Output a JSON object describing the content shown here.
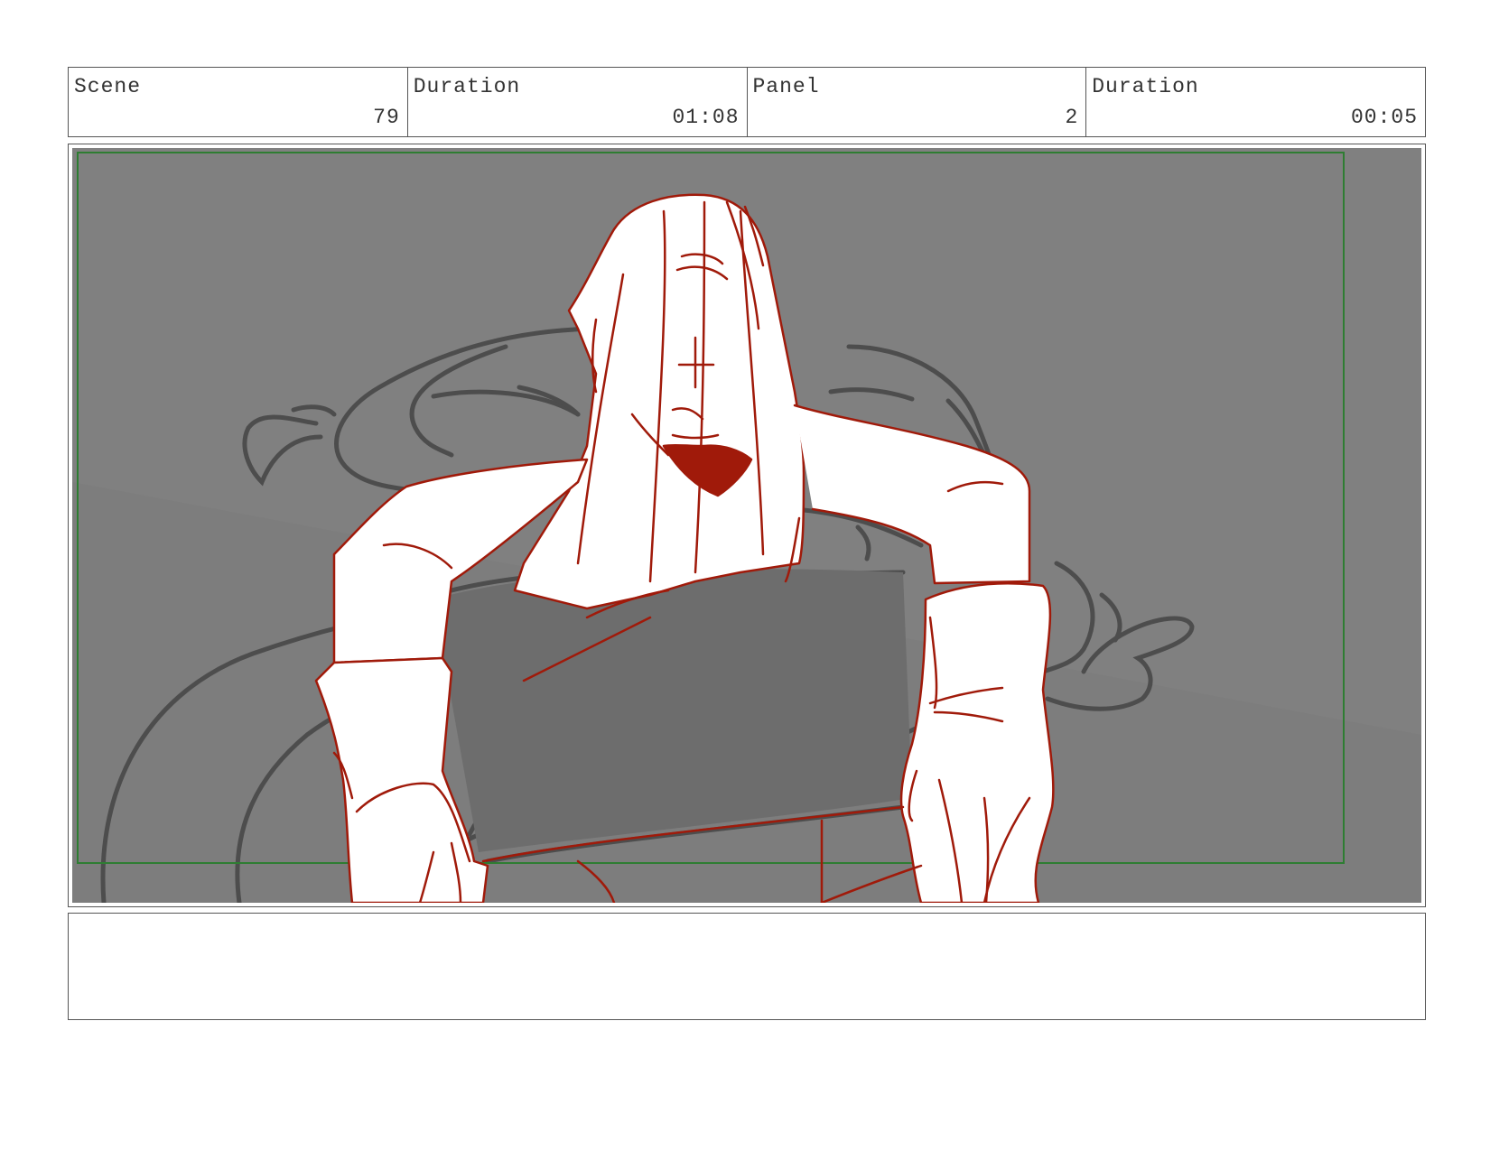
{
  "header": {
    "scene": {
      "label": "Scene",
      "value": "79"
    },
    "scene_duration": {
      "label": "Duration",
      "value": "01:08"
    },
    "panel": {
      "label": "Panel",
      "value": "2"
    },
    "panel_duration": {
      "label": "Duration",
      "value": "00:05"
    }
  },
  "notes": {
    "text": ""
  },
  "colors": {
    "background_gray": "#808080",
    "safe_frame_green": "#2e7d32",
    "sketch_red": "#a01a0a",
    "sketch_gray": "#4d4d4d"
  }
}
